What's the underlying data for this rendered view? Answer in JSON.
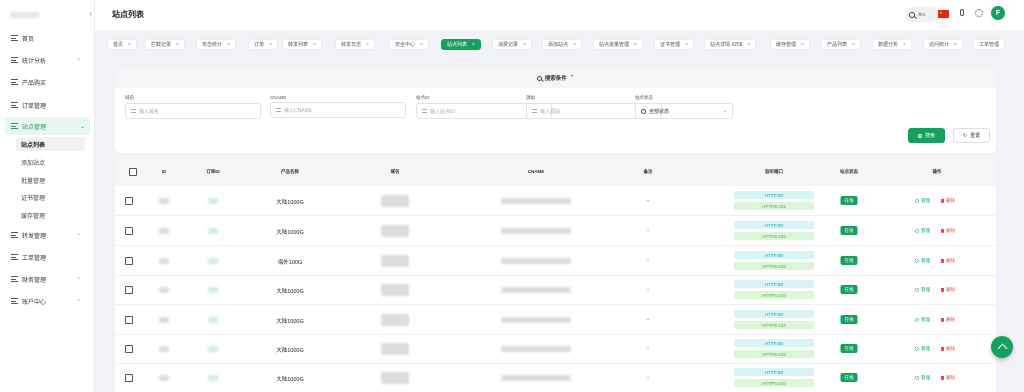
{
  "header": {
    "title": "站点列表",
    "search_shortcut": "⌘K",
    "avatar_letter": "F"
  },
  "sidebar": {
    "items": [
      {
        "label": "首页",
        "has_children": false
      },
      {
        "label": "统计分析",
        "has_children": true
      },
      {
        "label": "产品购买",
        "has_children": false
      },
      {
        "label": "订单管理",
        "has_children": false
      },
      {
        "label": "站点管理",
        "has_children": true,
        "expanded": true
      },
      {
        "label": "转发管理",
        "has_children": true
      },
      {
        "label": "工单管理",
        "has_children": false
      },
      {
        "label": "财务管理",
        "has_children": true
      },
      {
        "label": "账户中心",
        "has_children": true
      }
    ],
    "subitems": [
      "站点列表",
      "添加站点",
      "批量管理",
      "证书管理",
      "缓存管理"
    ],
    "active_sub": "站点列表"
  },
  "tabs": [
    {
      "label": "首页"
    },
    {
      "label": "拦截记录"
    },
    {
      "label": "攻击统计"
    },
    {
      "label": "订单"
    },
    {
      "label": "转发列表"
    },
    {
      "label": "转发日志"
    },
    {
      "label": "安全中心"
    },
    {
      "label": "站点列表",
      "active": true
    },
    {
      "label": "消费记录"
    },
    {
      "label": "添加站点"
    },
    {
      "label": "站点批量管理"
    },
    {
      "label": "证书管理"
    },
    {
      "label": "站点详情 #258"
    },
    {
      "label": "缓存管理"
    },
    {
      "label": "产品列表"
    },
    {
      "label": "数据分析"
    },
    {
      "label": "访问统计"
    },
    {
      "label": "工单管理"
    }
  ],
  "search": {
    "toggle_label": "搜索条件",
    "fields": [
      {
        "label": "域名",
        "placeholder": "输入域名"
      },
      {
        "label": "CNAME",
        "placeholder": "输入CNAME"
      },
      {
        "label": "站点ID",
        "placeholder": "输入站点ID"
      },
      {
        "label": "源站",
        "placeholder": "输入源站"
      }
    ],
    "status": {
      "label": "站点状态",
      "value": "全部状态"
    },
    "search_button": "搜索",
    "reset_button": "重置"
  },
  "table": {
    "columns": [
      "ID",
      "订单ID",
      "产品名称",
      "域名",
      "CNAME",
      "备注",
      "监听端口",
      "站点状态",
      "操作"
    ],
    "rows": [
      {
        "product": "大陆1000G",
        "remark": "-",
        "ports": [
          "HTTP:80",
          "HTTPS:443"
        ],
        "status": "在线"
      },
      {
        "product": "大陆1000G",
        "remark": "-",
        "ports": [
          "HTTP:80",
          "HTTPS:443"
        ],
        "status": "在线"
      },
      {
        "product": "海外100G",
        "remark": "-",
        "ports": [
          "HTTP:80",
          "HTTPS:443"
        ],
        "status": "在线"
      },
      {
        "product": "大陆1000G",
        "remark": "-",
        "ports": [
          "HTTP:80",
          "HTTPS:443"
        ],
        "status": "在线"
      },
      {
        "product": "大陆1000G",
        "remark": "-",
        "ports": [
          "HTTP:80",
          "HTTPS:443"
        ],
        "status": "在线"
      },
      {
        "product": "大陆1000G",
        "remark": "-",
        "ports": [
          "HTTP:80",
          "HTTPS:443"
        ],
        "status": "在线"
      },
      {
        "product": "大陆1000G",
        "remark": "-",
        "ports": [
          "HTTP:80",
          "HTTPS:443"
        ],
        "status": "在线"
      }
    ],
    "actions": {
      "manage": "管理",
      "delete": "删除"
    }
  },
  "colors": {
    "accent": "#16a05d",
    "danger": "#f0443a",
    "http": "#18a79c",
    "https": "#4caf3a"
  }
}
